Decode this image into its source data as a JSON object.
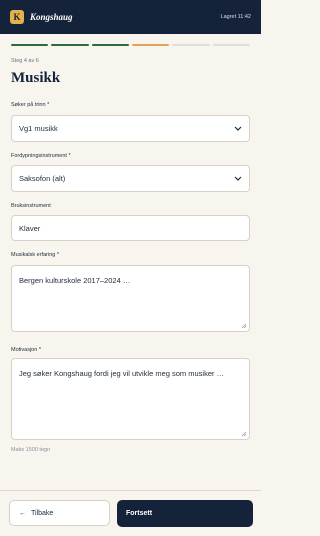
{
  "header": {
    "logo_letter": "K",
    "brand": "Kongshaug",
    "saved_status": "Lagret 11:42"
  },
  "progress": {
    "total_steps": 6,
    "current_step": 4,
    "steps": [
      "done",
      "done",
      "done",
      "current",
      "todo",
      "todo"
    ],
    "colors": {
      "done": "#2e6b3e",
      "current": "#e2a25a",
      "todo": "#e2dfd6"
    }
  },
  "step_label": "Steg 4 av 6",
  "page_title": "Musikk",
  "form": {
    "level": {
      "label": "Søker på trinn *",
      "value": "Vg1 musikk"
    },
    "instrument": {
      "label": "Fordypningsinstrument *",
      "value": "Saksofon (alt)"
    },
    "secondary": {
      "label": "Bruksinstrument",
      "value": "Klaver"
    },
    "experience": {
      "label": "Musikalsk erfaring *",
      "value": "Bergen kulturskole 2017–2024 …"
    },
    "motivation": {
      "label": "Motivasjon *",
      "value": "Jeg søker Kongshaug fordi jeg vil utvikle meg som musiker …",
      "hint": "Maks 1500 tegn"
    }
  },
  "actions": {
    "back_arrow": "←",
    "back_label": "Tilbake",
    "next_label": "Fortsett"
  },
  "colors": {
    "navy": "#15233a",
    "accent": "#e4b24a",
    "background": "#f7f5ee"
  },
  "icons": [
    "chevron-down-icon",
    "arrow-left-icon",
    "resize-handle-icon"
  ]
}
